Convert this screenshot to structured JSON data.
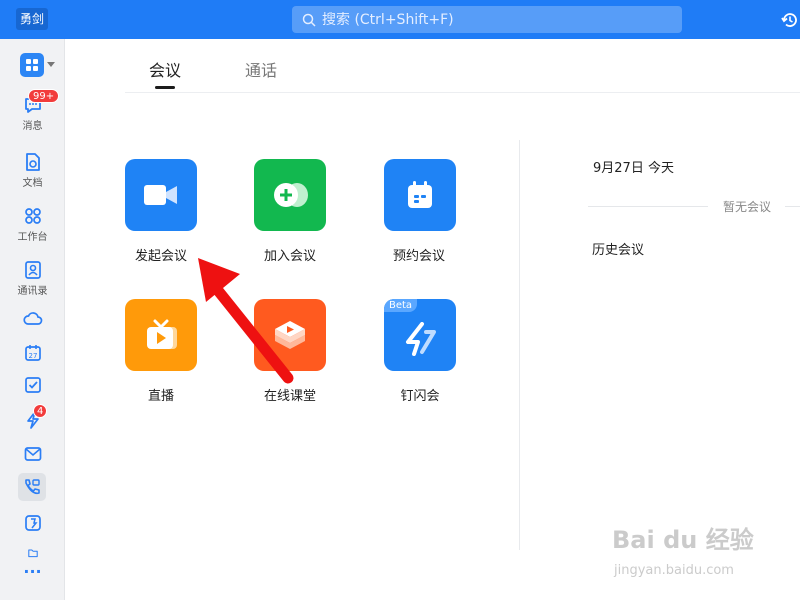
{
  "topbar": {
    "app_badge": "勇剑",
    "search_placeholder": "搜索 (Ctrl+Shift+F)"
  },
  "sidebar": {
    "items": [
      {
        "label": "消息",
        "icon": "message-icon",
        "badge": "99+"
      },
      {
        "label": "文档",
        "icon": "document-icon"
      },
      {
        "label": "工作台",
        "icon": "workbench-icon"
      },
      {
        "label": "通讯录",
        "icon": "contacts-icon"
      },
      {
        "label": "",
        "icon": "cloud-icon"
      },
      {
        "label": "",
        "icon": "calendar-icon",
        "text": "27"
      },
      {
        "label": "",
        "icon": "todo-icon"
      },
      {
        "label": "",
        "icon": "ding-icon",
        "badge": "4"
      },
      {
        "label": "",
        "icon": "mail-icon"
      },
      {
        "label": "",
        "icon": "meeting-icon"
      },
      {
        "label": "",
        "icon": "drive-icon"
      },
      {
        "label": "",
        "icon": "folder-icon"
      }
    ],
    "more": "···"
  },
  "tabs": [
    {
      "label": "会议",
      "active": true
    },
    {
      "label": "通话",
      "active": false
    }
  ],
  "tiles": [
    {
      "label": "发起会议",
      "icon": "video-camera-icon",
      "color": "#1f83f5"
    },
    {
      "label": "加入会议",
      "icon": "join-meeting-icon",
      "color": "#12b84f"
    },
    {
      "label": "预约会议",
      "icon": "schedule-icon",
      "color": "#1f83f5"
    },
    {
      "label": "直播",
      "icon": "live-tv-icon",
      "color": "#ff9a0a"
    },
    {
      "label": "在线课堂",
      "icon": "classroom-icon",
      "color": "#ff5a1f"
    },
    {
      "label": "钉闪会",
      "icon": "flash-meeting-icon",
      "color": "#1f83f5",
      "tag": "Beta"
    }
  ],
  "right_panel": {
    "date": "9月27日 今天",
    "empty_text": "暂无会议",
    "history_label": "历史会议"
  },
  "watermark": {
    "main": "Bai du 经验",
    "sub": "jingyan.baidu.com"
  },
  "annotation": {
    "color": "#ee1111"
  }
}
